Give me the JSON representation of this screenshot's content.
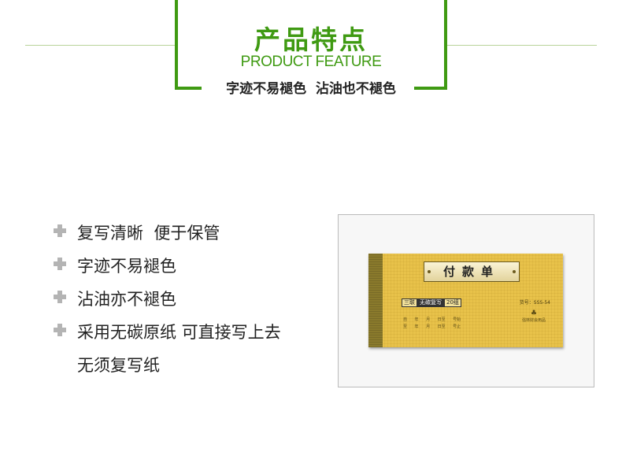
{
  "header": {
    "title_cn": "产品特点",
    "title_en": "PRODUCT FEATURE",
    "subtitle": "字迹不易褪色  沾油也不褪色"
  },
  "features": [
    "复写清晰  便于保管",
    "字迹不易褪色",
    "沾油亦不褪色",
    "采用无碳原纸 可直接写上去"
  ],
  "feature_continuation": "无须复写纸",
  "product": {
    "cover_title": "付款单",
    "tags": [
      "三联",
      "无碳复写",
      "20组"
    ],
    "model": "货号：SSS-54",
    "field_rows": [
      "自      年      月      日至      号始",
      "至      年      月      日至      号止"
    ],
    "brand_logo": "♣",
    "brand_text": "强林财会用品"
  },
  "colors": {
    "accent": "#3f9a12",
    "bullet": "#b4b4b4",
    "cover": "#e8c24a",
    "spine": "#8a7a2c"
  },
  "icons": {
    "bullet": "cross-bullet-icon",
    "brand": "clover-logo-icon"
  }
}
